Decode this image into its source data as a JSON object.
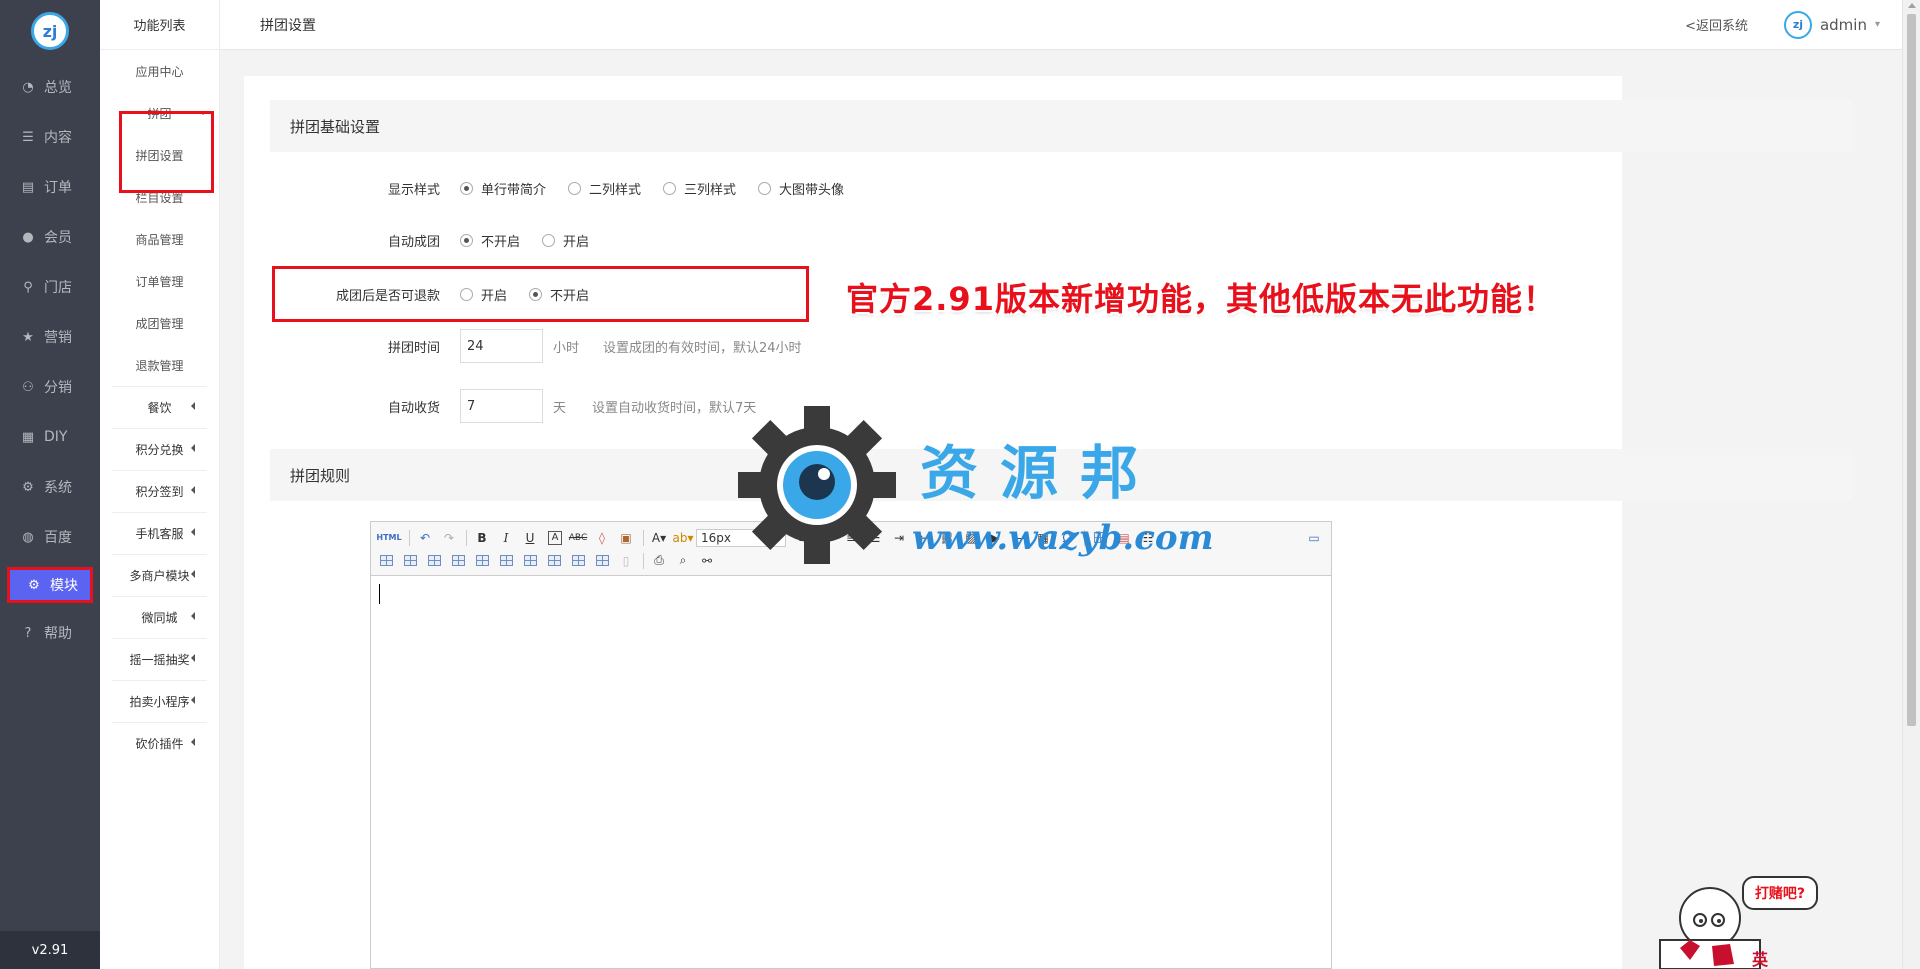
{
  "nav": {
    "logo": "zj",
    "items": [
      {
        "icon": "pie-chart-icon",
        "glyph": "◔",
        "label": "总览"
      },
      {
        "icon": "list-icon",
        "glyph": "☰",
        "label": "内容"
      },
      {
        "icon": "order-icon",
        "glyph": "▤",
        "label": "订单"
      },
      {
        "icon": "user-icon",
        "glyph": "●",
        "label": "会员"
      },
      {
        "icon": "location-icon",
        "glyph": "⚲",
        "label": "门店"
      },
      {
        "icon": "star-icon",
        "glyph": "★",
        "label": "营销"
      },
      {
        "icon": "users-icon",
        "glyph": "⚇",
        "label": "分销"
      },
      {
        "icon": "table-icon",
        "glyph": "▦",
        "label": "DIY"
      },
      {
        "icon": "gear-icon",
        "glyph": "⚙",
        "label": "系统"
      },
      {
        "icon": "baidu-icon",
        "glyph": "◍",
        "label": "百度"
      },
      {
        "icon": "module-gear-icon",
        "glyph": "⚙",
        "label": "模块"
      },
      {
        "icon": "help-icon",
        "glyph": "?",
        "label": "帮助"
      }
    ],
    "version": "v2.91"
  },
  "subnav": {
    "title": "功能列表",
    "top_items": [
      "应用中心"
    ],
    "group_open": "拼团",
    "group_items": [
      "拼团设置",
      "栏目设置",
      "商品管理",
      "订单管理",
      "成团管理",
      "退款管理"
    ],
    "groups": [
      "餐饮",
      "积分兑换",
      "积分签到",
      "手机客服",
      "多商户模块",
      "微同城",
      "摇一摇抽奖",
      "拍卖小程序",
      "砍价插件"
    ]
  },
  "header": {
    "title": "拼团设置",
    "back": "<返回系统",
    "user": "admin",
    "avatar": "zj"
  },
  "basic": {
    "title": "拼团基础设置",
    "display_style": {
      "label": "显示样式",
      "options": [
        "单行带简介",
        "二列样式",
        "三列样式",
        "大图带头像"
      ],
      "selected": 0
    },
    "auto_group": {
      "label": "自动成团",
      "options": [
        "不开启",
        "开启"
      ],
      "selected": 0
    },
    "refund": {
      "label": "成团后是否可退款",
      "options": [
        "开启",
        "不开启"
      ],
      "selected": 1
    },
    "group_time": {
      "label": "拼团时间",
      "value": "24",
      "unit": "小时",
      "help": "设置成团的有效时间，默认24小时"
    },
    "auto_receive": {
      "label": "自动收货",
      "value": "7",
      "unit": "天",
      "help": "设置自动收货时间，默认7天"
    }
  },
  "annotation": "官方2.91版本新增功能，其他低版本无此功能！",
  "rules": {
    "title": "拼团规则",
    "font_size": "16px",
    "html_btn": "HTML"
  },
  "watermark": {
    "text": "资源邦",
    "url": "www.wazyb.com"
  },
  "mascot": {
    "bubble": "打赌吧?",
    "shirt": "英"
  },
  "colors": {
    "sidebar": "#3d414d",
    "active": "#5b64f0",
    "highlight": "#e8101a",
    "brand": "#3aa8e8"
  }
}
